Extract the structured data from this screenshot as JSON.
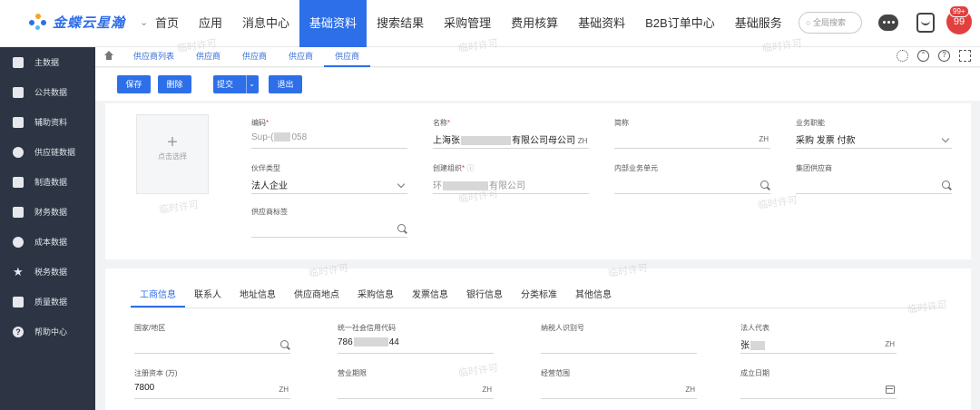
{
  "app": {
    "logo_text": "金蝶云星瀚",
    "brand_color": "#2d6fe8"
  },
  "nav": {
    "items": [
      {
        "label": "首页"
      },
      {
        "label": "应用"
      },
      {
        "label": "消息中心"
      },
      {
        "label": "基础资料",
        "active": true
      },
      {
        "label": "搜索结果"
      },
      {
        "label": "采购管理"
      },
      {
        "label": "费用核算"
      },
      {
        "label": "基础资料"
      },
      {
        "label": "B2B订单中心"
      },
      {
        "label": "基础服务"
      }
    ],
    "search_placeholder": "全局搜索",
    "badge": "99+",
    "avatar_text": "99"
  },
  "sidebar": {
    "items": [
      {
        "label": "主数据",
        "icon": "monitor-icon"
      },
      {
        "label": "公共数据",
        "icon": "folder-icon"
      },
      {
        "label": "辅助资料",
        "icon": "square-icon"
      },
      {
        "label": "供应链数据",
        "icon": "network-icon"
      },
      {
        "label": "制造数据",
        "icon": "factory-icon"
      },
      {
        "label": "财务数据",
        "icon": "layers-icon"
      },
      {
        "label": "成本数据",
        "icon": "coins-icon"
      },
      {
        "label": "税务数据",
        "icon": "star-icon"
      },
      {
        "label": "质量数据",
        "icon": "bar-icon"
      },
      {
        "label": "帮助中心",
        "icon": "help-icon"
      }
    ]
  },
  "tabs": [
    {
      "label": "供应商列表"
    },
    {
      "label": "供应商"
    },
    {
      "label": "供应商"
    },
    {
      "label": "供应商"
    },
    {
      "label": "供应商",
      "active": true
    }
  ],
  "toolbar": {
    "save": "保存",
    "delete": "删除",
    "submit": "提交",
    "exit": "退出"
  },
  "upload": {
    "plus": "+",
    "label": "点击选择"
  },
  "form": {
    "code": {
      "label": "编码",
      "value": "Sup-(",
      "value_tail": "058"
    },
    "name": {
      "label": "名称",
      "value": "上海张",
      "value_tail": "有限公司母公司",
      "suffix": "ZH"
    },
    "short_name": {
      "label": "简称",
      "value": "",
      "suffix": "ZH"
    },
    "biz_function": {
      "label": "业务职能",
      "value": "采购 发票 付款"
    },
    "partner_type": {
      "label": "伙伴类型",
      "value": "法人企业"
    },
    "create_org": {
      "label": "创建组织",
      "value": "环",
      "value_tail": "有限公司"
    },
    "internal_unit": {
      "label": "内部业务单元",
      "value": ""
    },
    "group_supplier": {
      "label": "集团供应商",
      "value": ""
    },
    "supplier_tag": {
      "label": "供应商标签",
      "value": ""
    }
  },
  "subtabs": [
    {
      "label": "工商信息",
      "active": true
    },
    {
      "label": "联系人"
    },
    {
      "label": "地址信息"
    },
    {
      "label": "供应商地点"
    },
    {
      "label": "采购信息"
    },
    {
      "label": "发票信息"
    },
    {
      "label": "银行信息"
    },
    {
      "label": "分类标准"
    },
    {
      "label": "其他信息"
    }
  ],
  "business_info": {
    "country": {
      "label": "国家/地区",
      "value": ""
    },
    "credit_code": {
      "label": "统一社会信用代码",
      "value": "786",
      "value_tail": "44"
    },
    "taxpayer_id": {
      "label": "纳税人识别号",
      "value": ""
    },
    "legal_rep": {
      "label": "法人代表",
      "value": "张",
      "suffix": "ZH"
    },
    "reg_capital": {
      "label": "注册资本 (万)",
      "value": "7800",
      "suffix": "ZH"
    },
    "biz_term": {
      "label": "营业期限",
      "value": "",
      "suffix": "ZH"
    },
    "biz_scope": {
      "label": "经营范围",
      "value": "",
      "suffix": "ZH"
    },
    "found_date": {
      "label": "成立日期",
      "value": ""
    }
  },
  "watermark": "临时许可"
}
